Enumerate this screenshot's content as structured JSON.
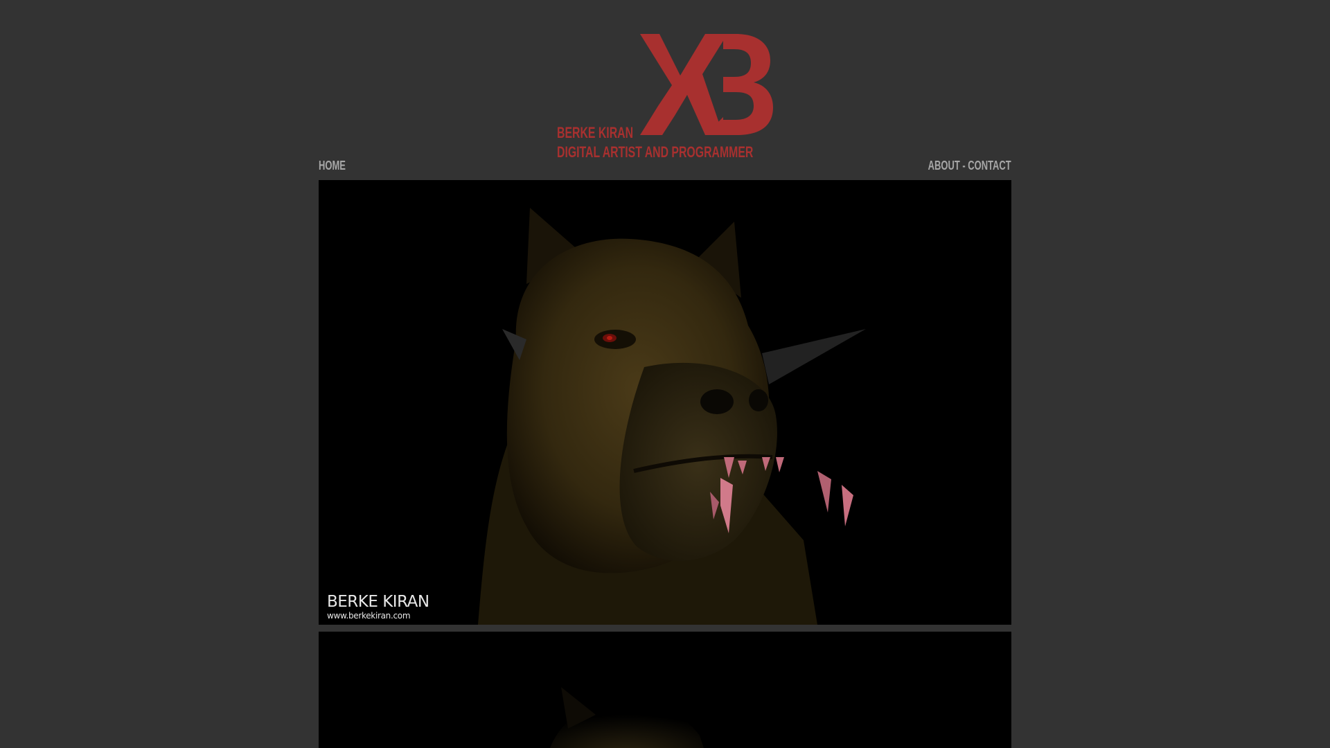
{
  "header": {
    "logo_icon": "kb-monogram-logo",
    "brand_name": "BERKE KIRAN",
    "tagline": "DIGITAL ARTIST AND PROGRAMMER",
    "brand_color": "#a8302f"
  },
  "nav": {
    "home_label": "HOME",
    "about_label": "ABOUT",
    "separator": " - ",
    "contact_label": "CONTACT"
  },
  "gallery": {
    "items": [
      {
        "subject": "creature-head-render",
        "watermark_name": "BERKE KIRAN",
        "watermark_url": "www.berkekiran.com"
      },
      {
        "subject": "creature-head-render"
      }
    ]
  },
  "colors": {
    "background": "#333333",
    "nav_text": "#a7a7a7",
    "image_bg": "#000000"
  }
}
